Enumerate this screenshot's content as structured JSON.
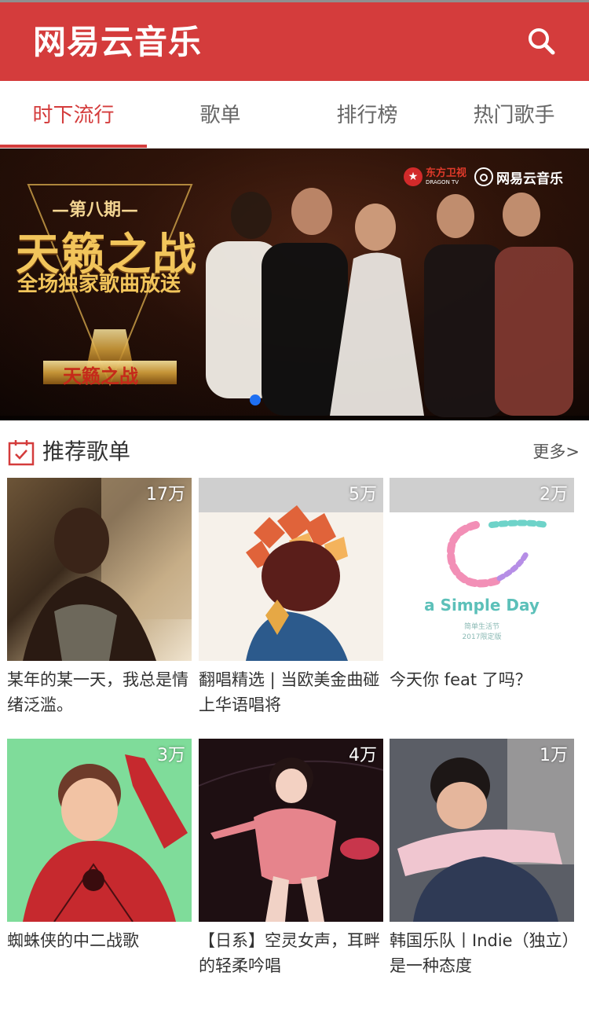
{
  "header": {
    "logo": "网易云音乐",
    "search_icon": "search-icon",
    "color": "#d43c3c"
  },
  "tabs": [
    {
      "label": "时下流行",
      "active": true
    },
    {
      "label": "歌单",
      "active": false
    },
    {
      "label": "排行榜",
      "active": false
    },
    {
      "label": "热门歌手",
      "active": false
    }
  ],
  "banner": {
    "issue": "—第八期—",
    "title": "天籁之战",
    "subtitle": "全场独家歌曲放送",
    "trophy_text": "天籁之战",
    "channel": "东方卫视",
    "channel_en": "DRAGON TV",
    "brand": "网易云音乐",
    "indicator_active": 1
  },
  "section": {
    "title": "推荐歌单",
    "more": "更多>",
    "icon": "calendar-check-icon"
  },
  "playlists": [
    {
      "count": "17万",
      "title": "某年的某一天，我总是情绪泛滥。"
    },
    {
      "count": "5万",
      "title": "翻唱精选 | 当欧美金曲碰上华语唱将"
    },
    {
      "count": "2万",
      "title": "今天你 feat 了吗？",
      "cover_text": "a Simple Day",
      "cover_subtext": "简单生活节\n2017限定版"
    },
    {
      "count": "3万",
      "title": "蜘蛛侠的中二战歌"
    },
    {
      "count": "4万",
      "title": "【日系】空灵女声，耳畔的轻柔吟唱"
    },
    {
      "count": "1万",
      "title": "韩国乐队丨Indie（独立）是一种态度"
    }
  ]
}
